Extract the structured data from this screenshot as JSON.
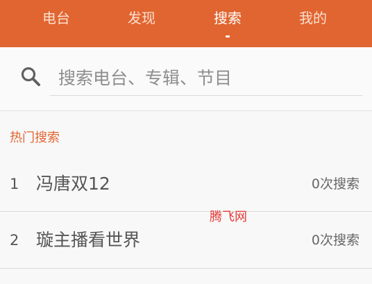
{
  "tabs": [
    {
      "label": "电台"
    },
    {
      "label": "发现"
    },
    {
      "label": "搜索"
    },
    {
      "label": "我的"
    }
  ],
  "active_tab": "搜索",
  "search": {
    "placeholder": "搜索电台、专辑、节目",
    "icon": "search-icon"
  },
  "hot": {
    "title": "热门搜索",
    "items": [
      {
        "rank": "1",
        "name": "冯唐双12",
        "count": "0次搜索"
      },
      {
        "rank": "2",
        "name": "璇主播看世界",
        "count": "0次搜索"
      }
    ]
  },
  "watermark": "腾飞网",
  "colors": {
    "accent": "#e16530",
    "background": "#f8f8f8",
    "watermark": "#e53935"
  }
}
